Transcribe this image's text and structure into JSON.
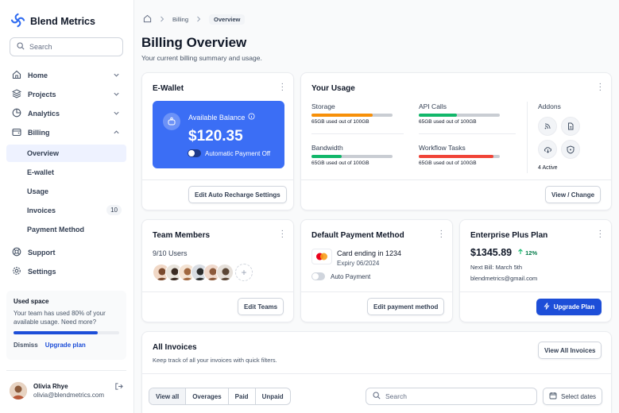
{
  "brand": {
    "name": "Blend Metrics"
  },
  "search": {
    "placeholder": "Search"
  },
  "nav": {
    "home": "Home",
    "projects": "Projects",
    "analytics": "Analytics",
    "billing": "Billing",
    "billing_items": [
      "Overview",
      "E-wallet",
      "Usage",
      "Invoices",
      "Payment Method"
    ],
    "invoices_count": "10",
    "support": "Support",
    "settings": "Settings"
  },
  "used_space": {
    "title": "Used space",
    "text": "Your team has used 80% of your available usage. Need more?",
    "percent": 80,
    "dismiss": "Dismiss",
    "upgrade": "Upgrade plan"
  },
  "user": {
    "name": "Olivia Rhye",
    "email": "olivia@blendmetrics.com"
  },
  "breadcrumb": {
    "billing": "Billing",
    "overview": "Overview"
  },
  "page": {
    "title": "Billing Overview",
    "subtitle": "Your current billing summary and usage."
  },
  "ewallet": {
    "title": "E-Wallet",
    "balance_label": "Available Balance",
    "balance": "$120.35",
    "auto_payment": "Automatic Payment Off",
    "button": "Edit Auto Recharge Settings"
  },
  "usage": {
    "title": "Your Usage",
    "items": [
      {
        "label": "Storage",
        "note": "65GB used out of 100GB",
        "fill": 0.75,
        "color": "#f79009"
      },
      {
        "label": "API Calls",
        "note": "65GB used out of 100GB",
        "fill": 0.47,
        "color": "#12b76a"
      },
      {
        "label": "Bandwidth",
        "note": "65GB used out of 100GB",
        "fill": 0.37,
        "color": "#12b76a"
      },
      {
        "label": "Workflow Tasks",
        "note": "65GB used out of 100GB",
        "fill": 0.92,
        "color": "#f04438"
      }
    ],
    "addons_label": "Addons",
    "addons_active": "4 Active",
    "button": "View / Change"
  },
  "team": {
    "title": "Team Members",
    "count": "9/10 Users",
    "button": "Edit Teams"
  },
  "payment": {
    "title": "Default Payment Method",
    "card": "Card ending in 1234",
    "expiry": "Expiry 06/2024",
    "auto": "Auto Payment",
    "button": "Edit payment method"
  },
  "plan": {
    "title": "Enterprise Plus Plan",
    "price": "$1345.89",
    "change": "12%",
    "next_bill": "Next Bill: March 5th",
    "email": "blendmetrics@gmail.com",
    "button": "Upgrade Plan"
  },
  "invoices": {
    "title": "All Invoices",
    "subtitle": "Keep track of all your invoices with quick filters.",
    "view_all": "View All Invoices",
    "tabs": [
      "View all",
      "Overages",
      "Paid",
      "Unpaid"
    ],
    "search_placeholder": "Search",
    "select_dates": "Select dates"
  }
}
